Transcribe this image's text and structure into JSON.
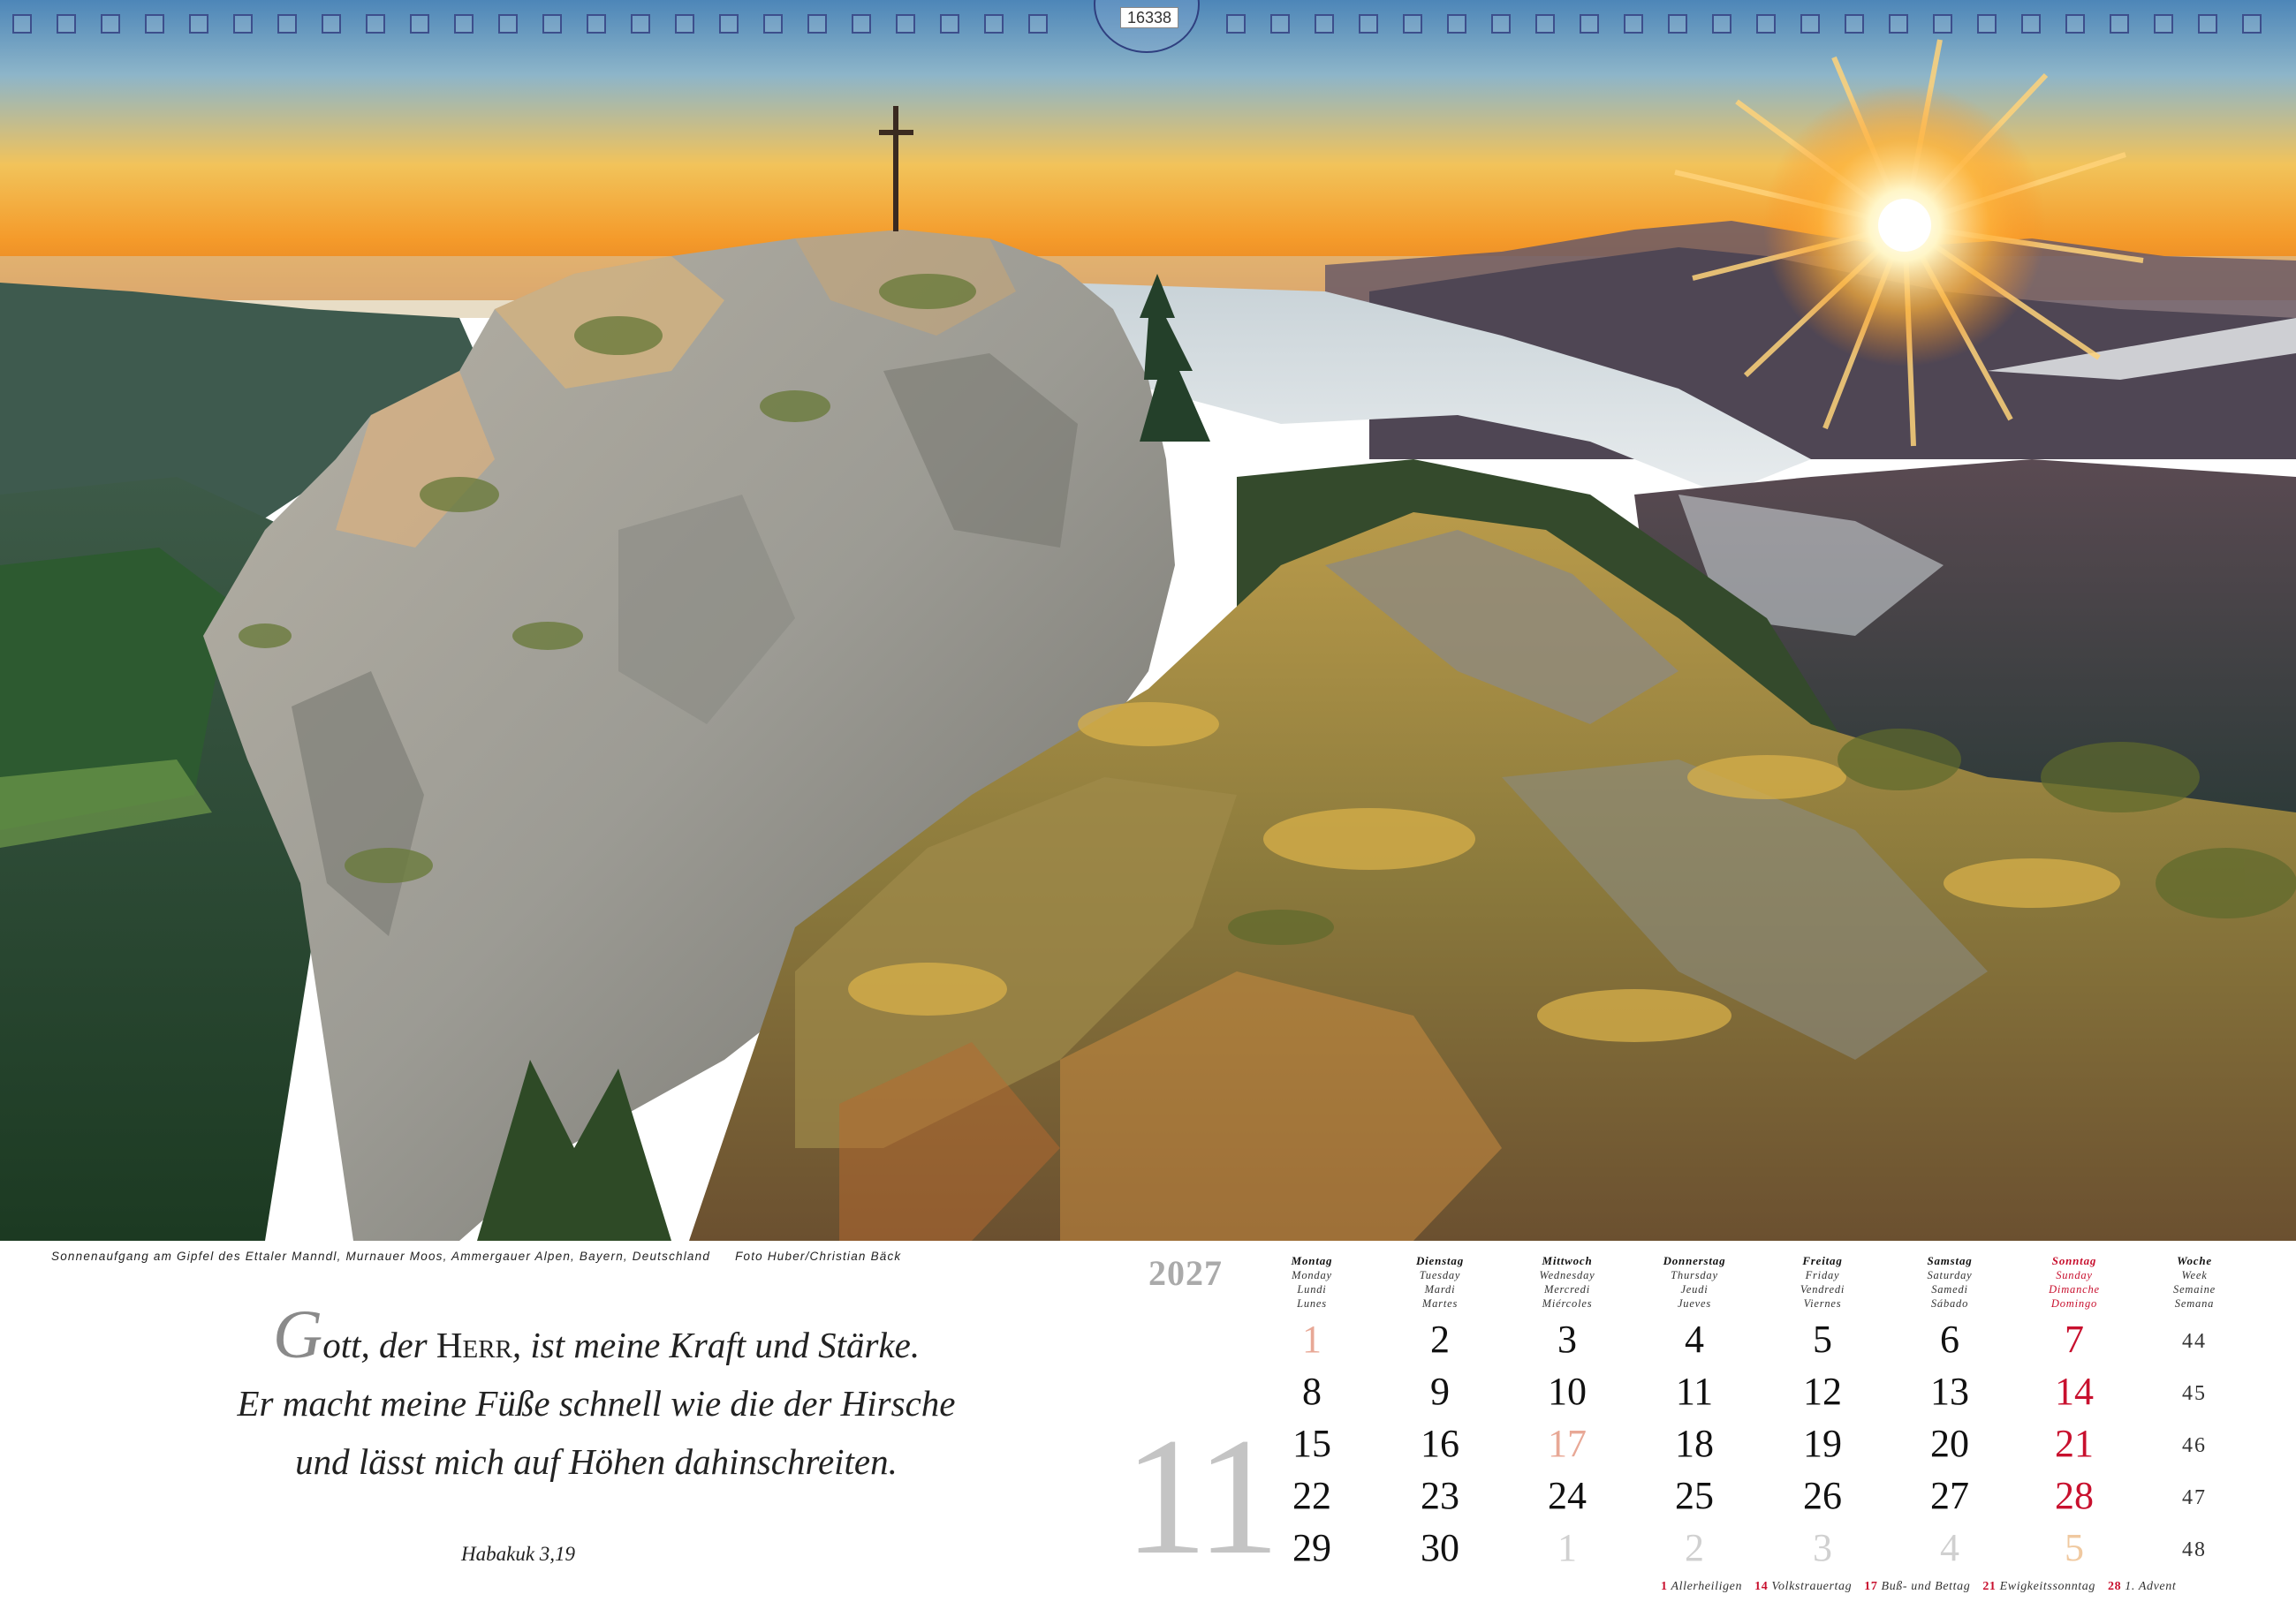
{
  "product_code": "16338",
  "caption": {
    "text": "Sonnenaufgang am Gipfel des Ettaler Manndl, Murnauer Moos, Ammergauer Alpen, Bayern, Deutschland",
    "credit": "Foto Huber/Christian Bäck"
  },
  "quote": {
    "dropcap": "G",
    "line1_a": "ott, der ",
    "line1_herr": "Herr",
    "line1_b": ", ist meine Kraft und Stärke.",
    "line2": "Er macht meine Füße schnell wie die der Hirsche",
    "line3": "und lässt mich auf Höhen dahinschreiten.",
    "source": "Habakuk 3,19"
  },
  "calendar": {
    "year": "2027",
    "month": "11",
    "weekdays": [
      {
        "main": "Montag",
        "l1": "Monday",
        "l2": "Lundi",
        "l3": "Lunes"
      },
      {
        "main": "Dienstag",
        "l1": "Tuesday",
        "l2": "Mardi",
        "l3": "Martes"
      },
      {
        "main": "Mittwoch",
        "l1": "Wednesday",
        "l2": "Mercredi",
        "l3": "Miércoles"
      },
      {
        "main": "Donnerstag",
        "l1": "Thursday",
        "l2": "Jeudi",
        "l3": "Jueves"
      },
      {
        "main": "Freitag",
        "l1": "Friday",
        "l2": "Vendredi",
        "l3": "Viernes"
      },
      {
        "main": "Samstag",
        "l1": "Saturday",
        "l2": "Samedi",
        "l3": "Sábado"
      },
      {
        "main": "Sonntag",
        "l1": "Sunday",
        "l2": "Dimanche",
        "l3": "Domingo"
      },
      {
        "main": "Woche",
        "l1": "Week",
        "l2": "Semaine",
        "l3": "Semana"
      }
    ],
    "rows": [
      {
        "week": "44",
        "days": [
          "1",
          "2",
          "3",
          "4",
          "5",
          "6",
          "7"
        ],
        "styles": [
          "hol",
          "",
          "",
          "",
          "",
          "",
          "sun"
        ]
      },
      {
        "week": "45",
        "days": [
          "8",
          "9",
          "10",
          "11",
          "12",
          "13",
          "14"
        ],
        "styles": [
          "",
          "",
          "",
          "",
          "",
          "",
          "sun"
        ]
      },
      {
        "week": "46",
        "days": [
          "15",
          "16",
          "17",
          "18",
          "19",
          "20",
          "21"
        ],
        "styles": [
          "",
          "",
          "hol",
          "",
          "",
          "",
          "sun"
        ]
      },
      {
        "week": "47",
        "days": [
          "22",
          "23",
          "24",
          "25",
          "26",
          "27",
          "28"
        ],
        "styles": [
          "",
          "",
          "",
          "",
          "",
          "",
          "sun"
        ]
      },
      {
        "week": "48",
        "days": [
          "29",
          "30",
          "1",
          "2",
          "3",
          "4",
          "5"
        ],
        "styles": [
          "",
          "",
          "other",
          "other",
          "other",
          "other",
          "other sun"
        ]
      }
    ],
    "holidays": [
      {
        "n": "1",
        "name": "Allerheiligen"
      },
      {
        "n": "14",
        "name": "Volkstrauertag"
      },
      {
        "n": "17",
        "name": "Buß- und Bettag"
      },
      {
        "n": "21",
        "name": "Ewigkeitssonntag"
      },
      {
        "n": "28",
        "name": "1. Advent"
      }
    ]
  },
  "colors": {
    "sunday": "#c8102e",
    "holiday": "#e8a896",
    "month_number": "#c4c4c4",
    "binding": "#3d4f8c"
  }
}
